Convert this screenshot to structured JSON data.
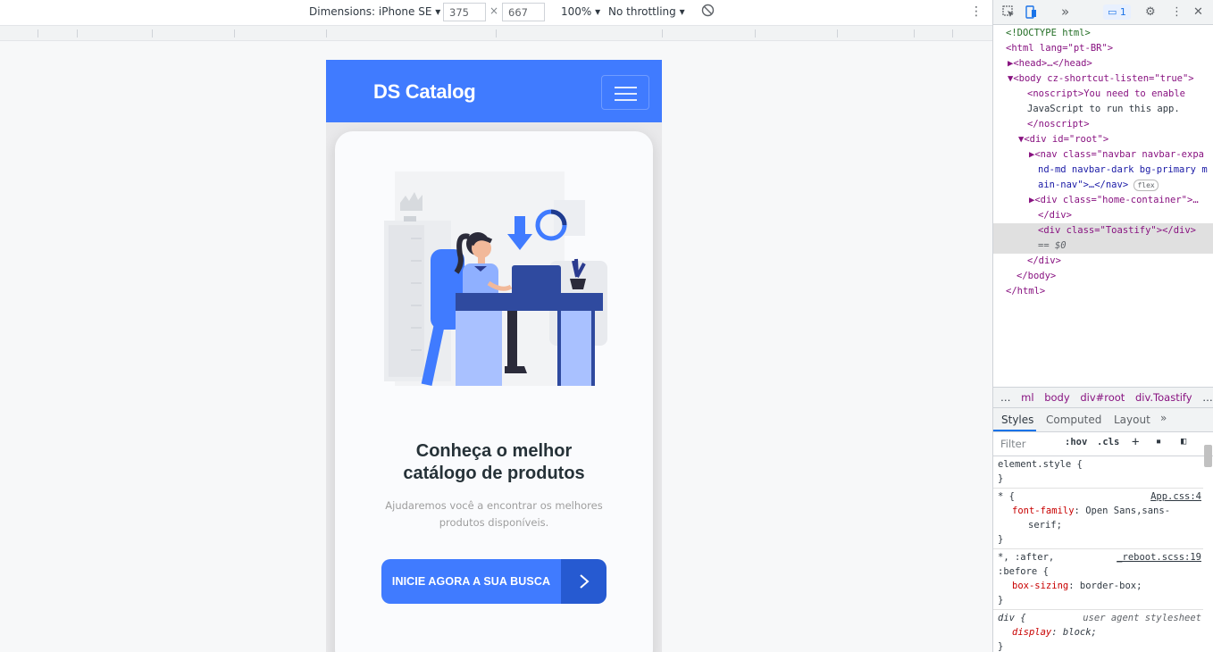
{
  "device_toolbar": {
    "dimensions_label": "Dimensions: iPhone SE",
    "width_value": "375",
    "times": "×",
    "height_value": "667",
    "zoom": "100%",
    "throttling": "No throttling"
  },
  "app": {
    "brand": "DS Catalog",
    "title": "Conheça o melhor catálogo de produtos",
    "subtitle": "Ajudaremos você a encontrar os melhores produtos disponíveis.",
    "cta_label": "INICIE AGORA A SUA BUSCA",
    "colors": {
      "primary": "#407bff",
      "primary_dark": "#265ad1",
      "title": "#263238",
      "subtitle": "#9e9e9e"
    }
  },
  "devtools": {
    "issues_count": "1",
    "dom": [
      "<!DOCTYPE html>",
      "<html lang=\"pt-BR\">",
      "▶<head>…</head>",
      "▼<body cz-shortcut-listen=\"true\">",
      "<noscript>You need to enable",
      "JavaScript to run this app.",
      "</noscript>",
      "▼<div id=\"root\">",
      "▶<nav class=\"navbar navbar-expa",
      "nd-md navbar-dark bg-primary m",
      "ain-nav\">…</nav>",
      "flex",
      "▶<div class=\"home-container\">…",
      "</div>",
      "<div class=\"Toastify\"></div>",
      "== $0",
      "</div>",
      "</body>",
      "</html>"
    ],
    "breadcrumbs": [
      "…",
      "ml",
      "body",
      "div#root",
      "div.Toastify",
      "…"
    ],
    "style_tabs": [
      "Styles",
      "Computed",
      "Layout"
    ],
    "filter_placeholder": "Filter",
    "hov": ":hov",
    "cls": ".cls",
    "rules": {
      "element_style": "element.style {",
      "close": "}",
      "r1_selector": "* {",
      "r1_src": "App.css:4",
      "r1_prop": "font-family",
      "r1_val": "Open Sans,sans-",
      "r1_val2": "serif;",
      "r2_selector": "*, :after,",
      "r2_selector2": ":before {",
      "r2_src": "_reboot.scss:19",
      "r2_prop": "box-sizing",
      "r2_val": "border-box;",
      "r3_selector": "div {",
      "r3_src": "user agent stylesheet",
      "r3_prop": "display",
      "r3_val": "block;"
    }
  }
}
